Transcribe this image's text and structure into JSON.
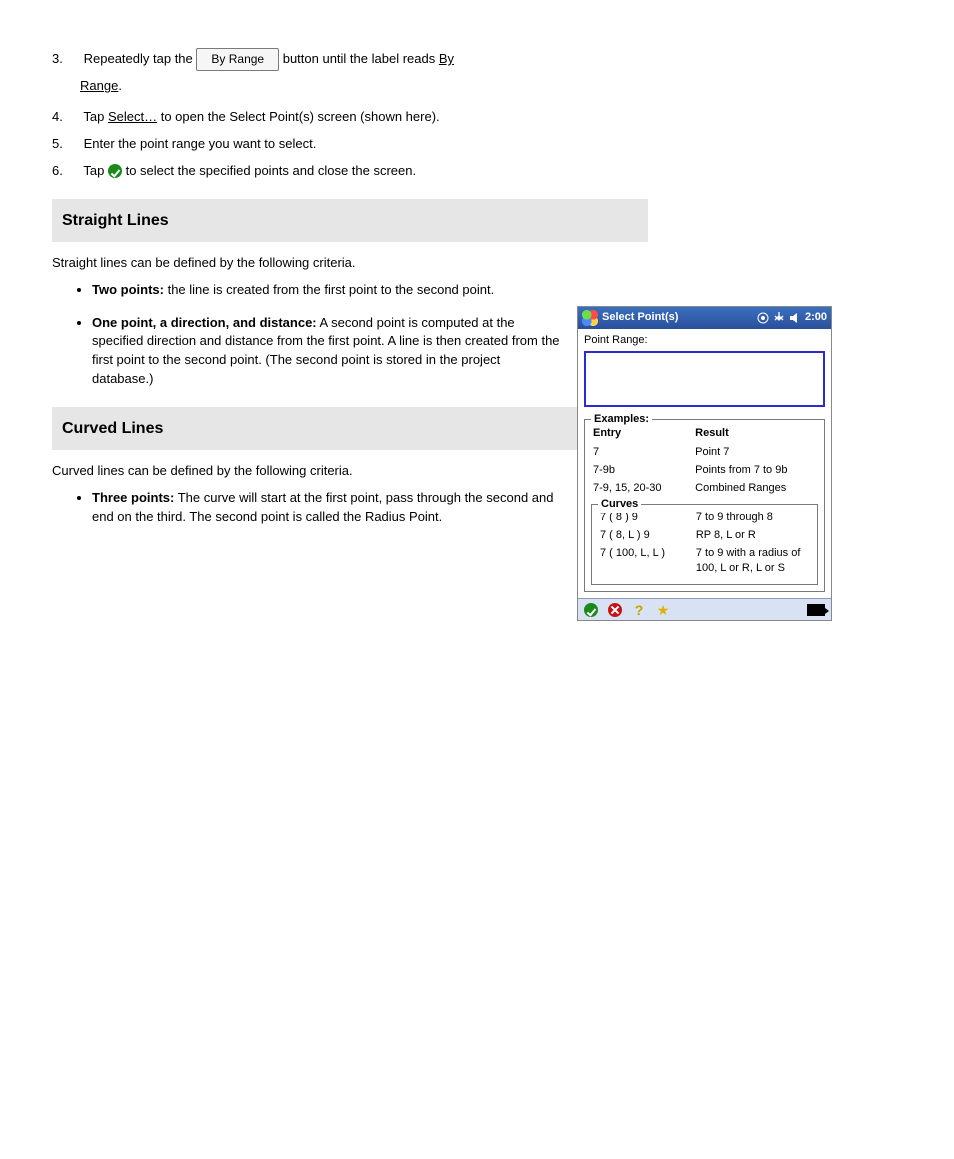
{
  "steps": {
    "three_num": "3.",
    "three_a": "Repeatedly tap the",
    "three_btn": "By Range",
    "three_b": " button until the label reads By Range.",
    "four_num": "4.",
    "four_a": "Tap ",
    "four_link": "Select…",
    "four_b": " to open the Select Point(s) screen (shown here).",
    "five_num": "5.",
    "five_a": "Enter the point range you want to select.",
    "six_num": "6.",
    "six_a": "Tap  to select the specified points and close the screen.",
    "six_b_prefix": "Tap ",
    "six_b_suffix": " to select the specified points and close the screen."
  },
  "sections": {
    "straight": {
      "title": "Straight Lines",
      "intro": "Straight lines can be defined by the following criteria.",
      "bullets": [
        {
          "bold": "Two points:",
          "rest": " the line is created from the first point to the second point."
        },
        {
          "bold": "One point, a direction, and distance:",
          "rest": " A second point is computed at the specified direction and distance from the first point. A line is then created from the first point to the second point. (The second point is stored in the project database.)"
        }
      ]
    },
    "curved": {
      "title": "Curved Lines",
      "intro": "Curved lines can be defined by the following criteria.",
      "bullets": [
        {
          "bold": "Three points:",
          "rest": " The curve will start at the first point, pass through the second and end on the third. The second point is called the Radius Point."
        }
      ]
    }
  },
  "ppc": {
    "title": "Select Point(s)",
    "time": "2:00",
    "label": "Point Range:",
    "input_value": "",
    "examples_legend": "Examples:",
    "entry_header": "Entry",
    "result_header": "Result",
    "examples": [
      {
        "entry": "7",
        "result": "Point 7"
      },
      {
        "entry": "7-9b",
        "result": "Points from 7 to 9b"
      },
      {
        "entry": "7-9, 15, 20-30",
        "result": "Combined Ranges"
      }
    ],
    "curves_legend": "Curves",
    "curves": [
      {
        "entry": "7 ( 8 ) 9",
        "result": "7 to 9 through 8"
      },
      {
        "entry": "7 ( 8, L ) 9",
        "result": "RP 8, L or R"
      },
      {
        "entry": "7 ( 100, L, L )",
        "result": "7 to 9 with a radius of 100, L or R, L or S"
      }
    ]
  }
}
